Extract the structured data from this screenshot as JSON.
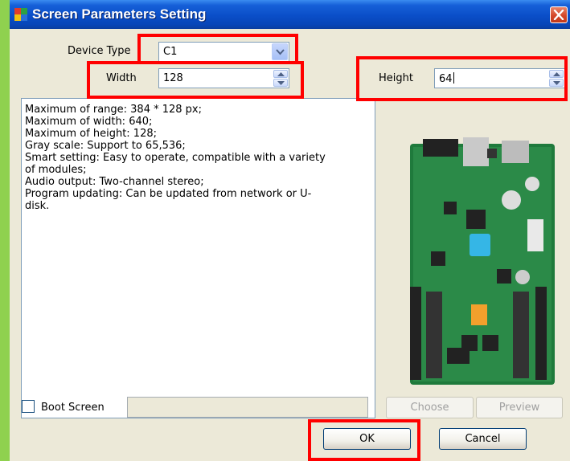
{
  "window": {
    "title": "Screen Parameters Setting"
  },
  "device_type": {
    "label": "Device Type",
    "value": "C1"
  },
  "width": {
    "label": "Width",
    "value": "128"
  },
  "height": {
    "label": "Height",
    "value": "64"
  },
  "info_lines": [
    "Maximum of range: 384 * 128 px;",
    "Maximum of width: 640;",
    "Maximum of height: 128;",
    "Gray scale: Support to 65,536;",
    "Smart setting: Easy to operate, compatible with a variety",
    "of modules;",
    "Audio output: Two-channel stereo;",
    "Program updating: Can be updated from network or U-",
    "disk."
  ],
  "boot_screen": {
    "label": "Boot Screen",
    "checked": false,
    "path": ""
  },
  "buttons": {
    "choose": "Choose",
    "preview": "Preview",
    "ok": "OK",
    "cancel": "Cancel"
  },
  "colors": {
    "highlight": "#ff0000",
    "titlebar": "#0a4ec8",
    "board": "#1f7a3c"
  }
}
